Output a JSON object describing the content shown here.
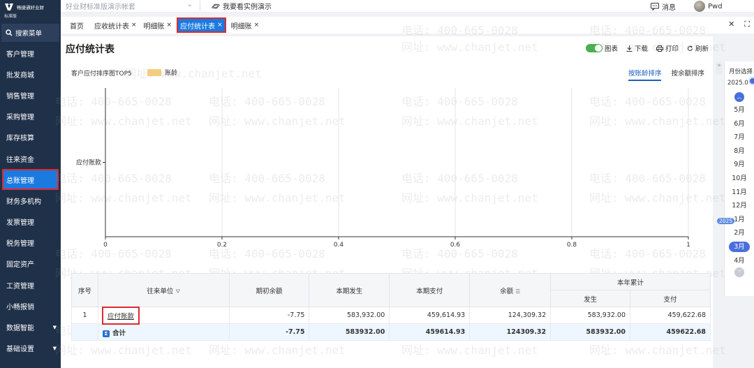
{
  "sidebar": {
    "logo_name": "畅捷通好业财",
    "logo_edition": "标准版",
    "search_label": "搜索菜单",
    "items": [
      {
        "label": "客户管理",
        "name": "customer",
        "caret": false
      },
      {
        "label": "批发商城",
        "name": "wholesale",
        "caret": false
      },
      {
        "label": "销售管理",
        "name": "sales",
        "caret": false
      },
      {
        "label": "采购管理",
        "name": "purchase",
        "caret": false
      },
      {
        "label": "库存核算",
        "name": "inventory",
        "caret": false
      },
      {
        "label": "往来资金",
        "name": "funds",
        "caret": false
      },
      {
        "label": "总账管理",
        "name": "ledger",
        "caret": false,
        "active": true
      },
      {
        "label": "财务多机构",
        "name": "multi-org",
        "caret": false
      },
      {
        "label": "发票管理",
        "name": "invoice",
        "caret": false
      },
      {
        "label": "税务管理",
        "name": "tax",
        "caret": false
      },
      {
        "label": "固定资产",
        "name": "fixed-assets",
        "caret": false
      },
      {
        "label": "工资管理",
        "name": "payroll",
        "caret": false
      },
      {
        "label": "小畅报销",
        "name": "expense",
        "caret": false
      },
      {
        "label": "数据智能",
        "name": "data-intel",
        "caret": true
      },
      {
        "label": "基础设置",
        "name": "basic-settings",
        "caret": true
      }
    ]
  },
  "topbar": {
    "account": "好业财标准版演示帐套",
    "demo_label": "我要看实例演示",
    "message_label": "消息",
    "user_name": "Pwd"
  },
  "tabs": [
    {
      "label": "首页",
      "closable": false,
      "active": false
    },
    {
      "label": "应收统计表",
      "closable": true,
      "active": false
    },
    {
      "label": "明细账",
      "closable": true,
      "active": false
    },
    {
      "label": "应付统计表",
      "closable": true,
      "active": true
    },
    {
      "label": "明细账",
      "closable": true,
      "active": false
    }
  ],
  "page": {
    "title": "应付统计表",
    "tools": {
      "chart": "图表",
      "download": "下载",
      "print": "打印",
      "refresh": "刷新"
    },
    "chart_caption": "客户应付排序图TOP5",
    "legend_label": "账龄",
    "sort_tabs": [
      {
        "label": "按账龄排序",
        "active": true
      },
      {
        "label": "按余额排序",
        "active": false
      }
    ]
  },
  "chart_data": {
    "type": "bar",
    "orientation": "horizontal",
    "categories": [
      "应付账款"
    ],
    "series": [
      {
        "name": "账龄",
        "values": [
          0
        ],
        "color": "#f2cd7f"
      }
    ],
    "xticks": [
      "0",
      "0.2",
      "0.4",
      "0.6",
      "0.8",
      "1"
    ],
    "xlim": [
      0,
      1
    ],
    "grid": true,
    "legend": "top-left"
  },
  "table": {
    "headers": {
      "seq": "序号",
      "unit": "往来单位",
      "opening": "期初余额",
      "current_occur": "本期发生",
      "current_pay": "本期支付",
      "balance": "余额",
      "ytd": "本年累计",
      "ytd_occur": "发生",
      "ytd_pay": "支付"
    },
    "rows": [
      {
        "seq": "1",
        "unit": "应付账款",
        "opening": "-7.75",
        "occur": "583,932.00",
        "pay": "459,614.93",
        "balance": "124,309.32",
        "ytd_occur": "583,932.00",
        "ytd_pay": "459,622.68"
      }
    ],
    "total": {
      "label": "合计",
      "badge": "Σ",
      "opening": "-7.75",
      "occur": "583932.00",
      "pay": "459614.93",
      "balance": "124309.32",
      "ytd_occur": "583932.00",
      "ytd_pay": "459622.68"
    }
  },
  "month_panel": {
    "title": "月份选择",
    "current": "2025.0",
    "year_badge": "2025",
    "months": [
      "5月",
      "6月",
      "7月",
      "8月",
      "9月",
      "10月",
      "11月",
      "12月",
      "1月",
      "2月",
      "3月",
      "4月"
    ],
    "active_month": "3月"
  },
  "watermark": {
    "phone": "电话: 400-665-0028",
    "site": "网址: www.chanjet.net"
  },
  "colors": {
    "sidebar": "#1f3049",
    "accent": "#1b7ae0",
    "highlight": "#e0282e",
    "legend": "#f2cd7f"
  }
}
